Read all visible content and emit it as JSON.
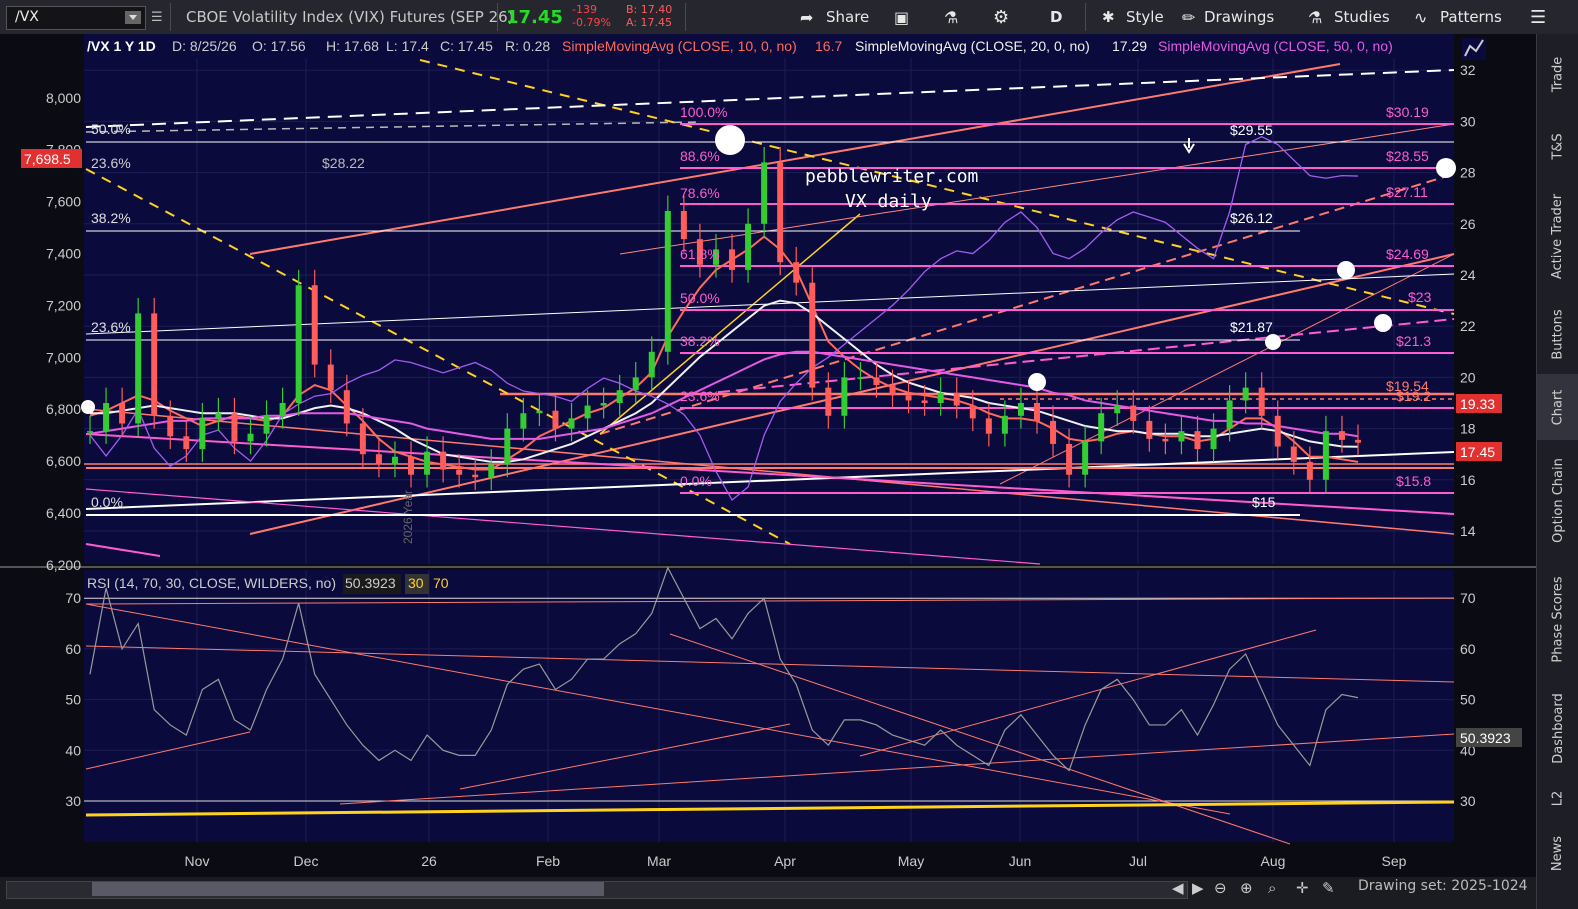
{
  "toolbar": {
    "symbol": "/VX",
    "title": "CBOE Volatility Index (VIX) Futures (SEP 26)",
    "last": "17.45",
    "change": "-139",
    "change_pct": "-0.79%",
    "bid": "B: 17.40",
    "ask": "A: 17.45",
    "share": "Share",
    "period": "D",
    "style": "Style",
    "drawings": "Drawings",
    "studies": "Studies",
    "patterns": "Patterns",
    "colors": {
      "last": "#22dd22",
      "change": "#ff4444"
    }
  },
  "side_tabs": [
    "Trade",
    "T&S",
    "Active Trader",
    "Buttons",
    "Chart",
    "Option Chain",
    "Phase Scores",
    "Dashboard",
    "L2",
    "News"
  ],
  "bottom": {
    "drawing_set": "Drawing set: 2025-1024"
  },
  "header": {
    "symbol": "/VX 1 Y 1D",
    "d": "D: 8/25/26",
    "o": "O: 17.56",
    "h": "H: 17.68",
    "l": "L: 17.4",
    "c": "C: 17.45",
    "r": "R: 0.28",
    "sma10": "SimpleMovingAvg (CLOSE, 10, 0, no)",
    "sma10_val": "16.7",
    "sma20": "SimpleMovingAvg (CLOSE, 20, 0, no)",
    "sma20_val": "17.29",
    "sma50": "SimpleMovingAvg (CLOSE, 50, 0, no)",
    "rsi": "RSI (14, 70, 30, CLOSE, WILDERS, no)",
    "rsi_val": "50.3923",
    "rsi_ob": "30",
    "rsi_os": "70"
  },
  "annotations": {
    "site": "pebblewriter.com",
    "subtitle": "VX daily",
    "year_marker": "2026 Year",
    "fib_left": [
      "50.0%",
      "23.6%",
      "38.2%",
      "23.6%",
      "0.0%"
    ],
    "fib_mid": [
      "100.0%",
      "88.6%",
      "78.6%",
      "61.8%",
      "50.0%",
      "38.2%",
      "23.6%",
      "0.0%"
    ],
    "spx_tag": "7,698.5",
    "price_labels": {
      "p2822": "$28.22",
      "p2955": "$29.55",
      "p2612": "$26.12",
      "p2187": "$21.87",
      "p15": "$15",
      "p3019": "$30.19",
      "p2855": "$28.55",
      "p2711": "$27.11",
      "p2469": "$24.69",
      "p23": "$23",
      "p213": "$21.3",
      "p1954": "$19.54",
      "p192": "$19.2",
      "p158": "$15.8"
    },
    "tags": {
      "t1933": "19.33",
      "t1745": "17.45",
      "t503923": "50.3923"
    },
    "colors": {
      "magenta": "#ff5ccf",
      "salmon": "#ff7a6e",
      "yellow": "#ffd21f",
      "white": "#ffffff"
    }
  },
  "chart_data": [
    {
      "type": "line",
      "title": "/VX 1 Y 1D",
      "x_ticks": [
        "Nov",
        "Dec",
        "26",
        "Feb",
        "Mar",
        "Apr",
        "May",
        "Jun",
        "Jul",
        "Aug",
        "Sep"
      ],
      "y_left_ticks": [
        "8,000",
        "7,800",
        "7,600",
        "7,400",
        "7,200",
        "7,000",
        "6,800",
        "6,600",
        "6,400",
        "6,200"
      ],
      "y_right_ticks": [
        "32",
        "30",
        "28",
        "26",
        "24",
        "22",
        "20",
        "18",
        "16",
        "14"
      ],
      "ylim": [
        13.5,
        33.5
      ],
      "series": [
        {
          "name": "/VX",
          "color": "#3fbf3f",
          "values": [
            17.9,
            19.0,
            18.2,
            22.5,
            18.5,
            17.7,
            17.2,
            18.4,
            18.6,
            17.5,
            17.8,
            18.5,
            19.0,
            23.6,
            20.5,
            19.5,
            18.2,
            17.0,
            16.6,
            16.9,
            16.2,
            17.1,
            16.4,
            16.2,
            16.1,
            16.6,
            18.0,
            18.6,
            18.7,
            18.0,
            18.4,
            18.9,
            19.0,
            19.5,
            20.0,
            21.0,
            26.5,
            25.4,
            24.4,
            25.0,
            24.2,
            26.0,
            28.4,
            24.5,
            23.7,
            19.6,
            18.5,
            20.0,
            20.0,
            19.7,
            19.3,
            19.1,
            19.0,
            19.4,
            18.9,
            18.4,
            17.8,
            18.5,
            19.0,
            18.3,
            17.4,
            16.2,
            17.5,
            18.6,
            18.9,
            18.3,
            17.6,
            17.5,
            17.9,
            17.2,
            18.0,
            19.1,
            19.6,
            18.5,
            17.3,
            16.7,
            16.0,
            17.9,
            17.56,
            17.45
          ]
        },
        {
          "name": "SimpleMovingAvg (CLOSE, 10, 0, no)",
          "color": "#ff6a5c",
          "values": [
            18.5,
            18.7,
            19.0,
            19.3,
            19.1,
            18.7,
            18.4,
            18.1,
            18.3,
            18.5,
            18.4,
            18.3,
            18.5,
            19.3,
            19.7,
            19.5,
            18.9,
            18.3,
            17.6,
            17.1,
            16.9,
            16.7,
            16.6,
            16.5,
            16.4,
            16.4,
            16.8,
            17.2,
            17.7,
            18.0,
            18.3,
            18.6,
            18.8,
            19.2,
            19.6,
            20.2,
            21.6,
            22.6,
            23.5,
            24.2,
            24.6,
            25.0,
            25.5,
            25.0,
            24.2,
            22.8,
            21.4,
            20.8,
            20.3,
            19.9,
            19.6,
            19.4,
            19.3,
            19.2,
            19.1,
            18.9,
            18.6,
            18.4,
            18.4,
            18.3,
            18.0,
            17.6,
            17.5,
            17.6,
            17.8,
            17.9,
            17.8,
            17.7,
            17.7,
            17.5,
            17.6,
            18.0,
            18.4,
            18.4,
            18.0,
            17.5,
            16.9,
            16.9,
            16.8,
            16.7
          ]
        },
        {
          "name": "SimpleMovingAvg (CLOSE, 20, 0, no)",
          "color": "#f0f0f0",
          "values": [
            18.6,
            18.6,
            18.7,
            18.8,
            18.9,
            18.8,
            18.7,
            18.6,
            18.6,
            18.6,
            18.5,
            18.4,
            18.4,
            18.6,
            18.8,
            18.9,
            18.8,
            18.6,
            18.3,
            18.0,
            17.6,
            17.3,
            17.0,
            16.9,
            16.8,
            16.7,
            16.7,
            16.8,
            17.0,
            17.2,
            17.4,
            17.7,
            18.0,
            18.3,
            18.6,
            19.0,
            19.6,
            20.2,
            20.8,
            21.3,
            21.8,
            22.3,
            22.8,
            23.0,
            22.9,
            22.5,
            22.0,
            21.5,
            21.0,
            20.5,
            20.1,
            19.8,
            19.6,
            19.4,
            19.3,
            19.2,
            19.0,
            18.9,
            18.8,
            18.7,
            18.5,
            18.3,
            18.1,
            18.0,
            17.9,
            17.9,
            17.8,
            17.8,
            17.8,
            17.7,
            17.7,
            17.8,
            17.9,
            18.0,
            17.9,
            17.7,
            17.5,
            17.4,
            17.3,
            17.29
          ]
        },
        {
          "name": "SimpleMovingAvg (CLOSE, 50, 0, no)",
          "color": "#e45ae4",
          "values": [
            17.8,
            17.9,
            18.0,
            18.1,
            18.2,
            18.3,
            18.3,
            18.4,
            18.4,
            18.4,
            18.4,
            18.5,
            18.5,
            18.6,
            18.6,
            18.6,
            18.6,
            18.5,
            18.4,
            18.3,
            18.2,
            18.0,
            17.9,
            17.8,
            17.7,
            17.6,
            17.6,
            17.6,
            17.6,
            17.7,
            17.8,
            17.9,
            18.0,
            18.2,
            18.4,
            18.6,
            18.9,
            19.2,
            19.5,
            19.8,
            20.1,
            20.4,
            20.7,
            20.9,
            21.0,
            21.0,
            20.9,
            20.8,
            20.7,
            20.6,
            20.5,
            20.4,
            20.3,
            20.2,
            20.1,
            20.0,
            19.9,
            19.8,
            19.7,
            19.6,
            19.4,
            19.3,
            19.1,
            19.0,
            18.9,
            18.8,
            18.7,
            18.6,
            18.5,
            18.4,
            18.3,
            18.3,
            18.2,
            18.2,
            18.1,
            18.0,
            17.9,
            17.8,
            17.8,
            17.7
          ]
        },
        {
          "name": "SPX",
          "color": "#a25cf0",
          "values": [
            6700,
            6620,
            6700,
            6800,
            6650,
            6580,
            6620,
            6700,
            6720,
            6650,
            6600,
            6680,
            6780,
            6820,
            6850,
            6860,
            6900,
            6930,
            6950,
            6990,
            6980,
            6960,
            6940,
            6960,
            6980,
            6950,
            6900,
            6870,
            6860,
            6850,
            6830,
            6880,
            6920,
            6900,
            6870,
            6850,
            6820,
            6780,
            6700,
            6560,
            6450,
            6500,
            6700,
            6830,
            6900,
            6960,
            7000,
            7050,
            7100,
            7150,
            7200,
            7260,
            7330,
            7380,
            7410,
            7400,
            7450,
            7520,
            7560,
            7500,
            7400,
            7380,
            7420,
            7480,
            7530,
            7560,
            7540,
            7520,
            7470,
            7420,
            7380,
            7560,
            7820,
            7850,
            7820,
            7760,
            7700,
            7690,
            7700,
            7698.5
          ]
        }
      ]
    },
    {
      "type": "line",
      "title": "RSI (14, 70, 30, CLOSE, WILDERS, no)",
      "y_ticks": [
        "70",
        "60",
        "50",
        "40",
        "30"
      ],
      "ylim": [
        28,
        79
      ],
      "series": [
        {
          "name": "RSI",
          "color": "#9a9a9a",
          "values": [
            55,
            72,
            60,
            65,
            48,
            45,
            43,
            52,
            54,
            46,
            44,
            52,
            58,
            69,
            55,
            50,
            45,
            41,
            38,
            40,
            38,
            43,
            40,
            39,
            39,
            44,
            53,
            56,
            57,
            52,
            54,
            58,
            58,
            61,
            63,
            67,
            76,
            70,
            64,
            66,
            62,
            67,
            70,
            58,
            53,
            44,
            41,
            46,
            46,
            45,
            43,
            42,
            41,
            44,
            41,
            39,
            37,
            44,
            47,
            43,
            39,
            36,
            45,
            52,
            54,
            50,
            45,
            45,
            48,
            43,
            49,
            56,
            59,
            52,
            45,
            41,
            37,
            48,
            51,
            50.39
          ]
        }
      ]
    }
  ]
}
